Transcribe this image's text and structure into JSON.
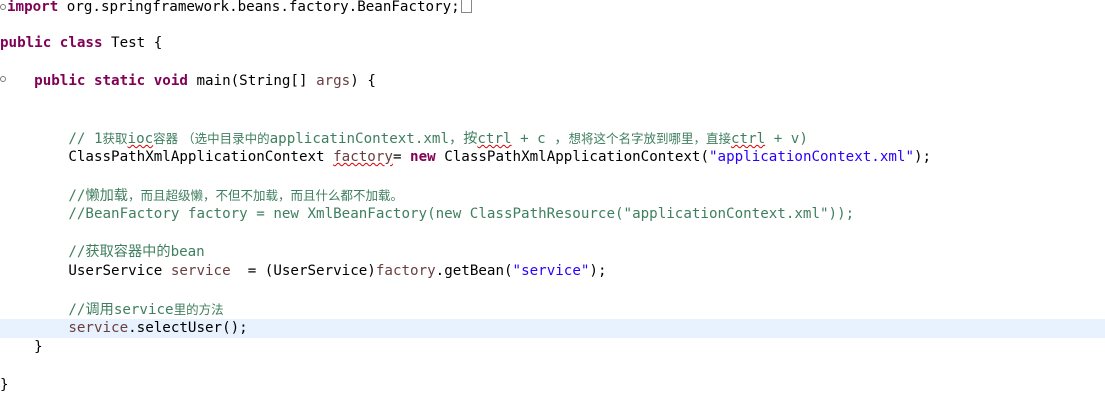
{
  "code": {
    "line1": {
      "kw": "import",
      "pkg": " org.springframework.beans.factory.BeanFactory;"
    },
    "line3": {
      "kw1": "public",
      "kw2": "class",
      "name": " Test {"
    },
    "line5": {
      "indent": "    ",
      "kw1": "public",
      "kw2": "static",
      "kw3": "void",
      "sig_a": " main(String[] ",
      "arg": "args",
      "sig_b": ") {"
    },
    "line8": {
      "indent": "        ",
      "a": "// 1",
      "b": "获取",
      "c": "ioc",
      "d": "容器 （选中目录中的",
      "e": "applicatinContext.xml，按",
      "f": "ctrl",
      "g": " + c ，",
      "h": "想将这个名字放到哪里，直接",
      "i": "ctrl",
      "j": " + v)"
    },
    "line9": {
      "indent": "        ",
      "type": "ClassPathXmlApplicationContext ",
      "var": "factory",
      "eq": "= ",
      "kw": "new",
      "ctor": " ClassPathXmlApplicationContext(",
      "str": "\"applicationContext.xml\"",
      "end": ");"
    },
    "line11": {
      "indent": "        ",
      "a": "//懒加载",
      "b": "，而且超级懒，不但不加载，而且什么都不加载。"
    },
    "line12": {
      "indent": "        ",
      "text": "//BeanFactory factory = new XmlBeanFactory(new ClassPathResource(\"applicationContext.xml\"));"
    },
    "line14": {
      "indent": "        ",
      "a": "//获取容器中的",
      "b": "bean"
    },
    "line15": {
      "indent": "        ",
      "type": "UserService ",
      "var": "service",
      "mid": "  = (UserService)",
      "var2": "factory",
      "call": ".getBean(",
      "str": "\"service\"",
      "end": ");"
    },
    "line17": {
      "indent": "        ",
      "a": "//调用",
      "b": "service",
      "c": "里的方法"
    },
    "line18": {
      "indent": "        ",
      "var": "service",
      "call": ".selectUser();"
    },
    "line19": {
      "text": "    }"
    },
    "line21": {
      "text": "}"
    }
  }
}
